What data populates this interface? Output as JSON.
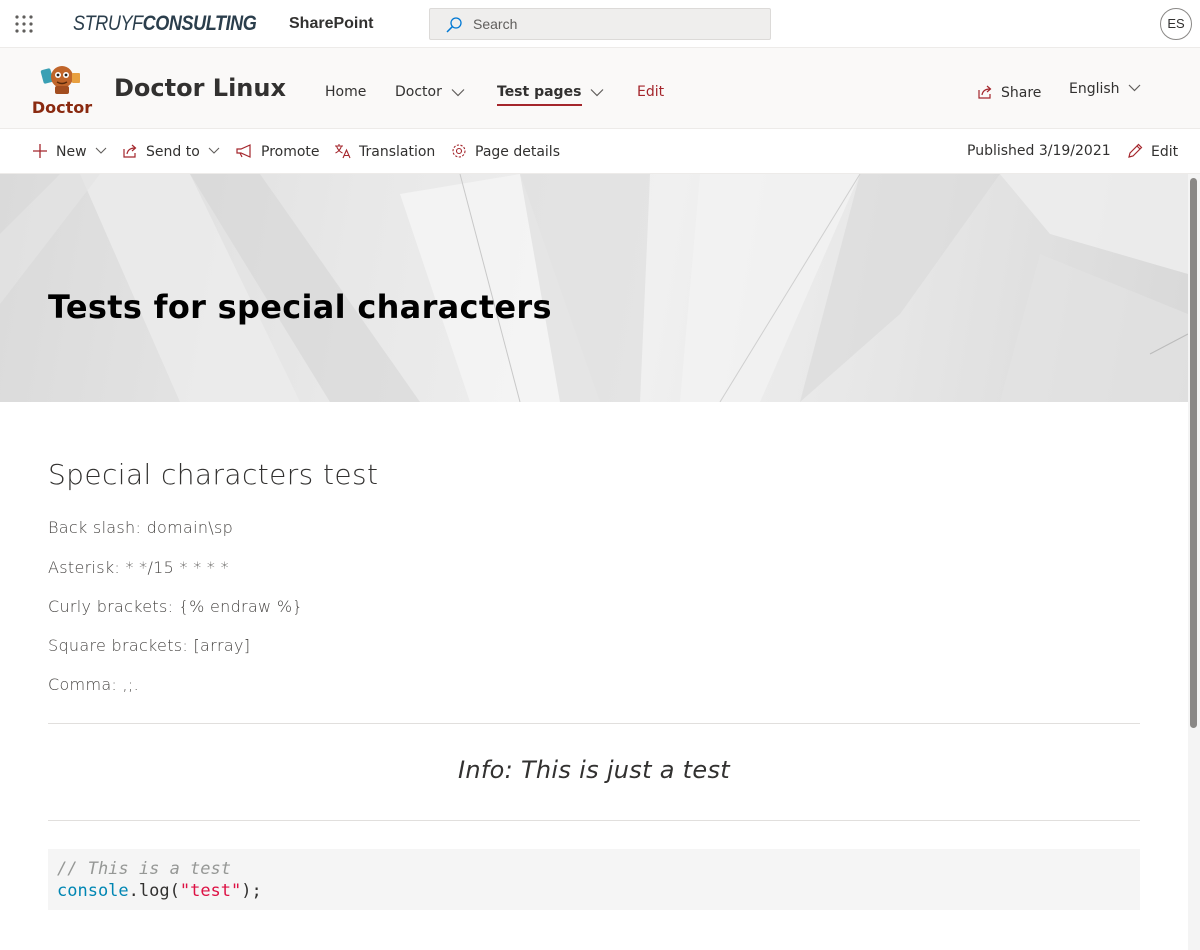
{
  "suite_bar": {
    "brand_part1": "STRUYF",
    "brand_part2": "CONSULTING",
    "app_name": "SharePoint",
    "search_placeholder": "Search",
    "user_initials": "ES"
  },
  "site_header": {
    "logo_text": "Doctor",
    "site_title": "Doctor Linux",
    "nav": [
      {
        "label": "Home"
      },
      {
        "label": "Doctor"
      },
      {
        "label": "Test pages"
      },
      {
        "label": "Edit"
      }
    ],
    "share_label": "Share",
    "language": "English"
  },
  "command_bar": {
    "new_label": "New",
    "send_to_label": "Send to",
    "promote_label": "Promote",
    "translation_label": "Translation",
    "page_details_label": "Page details",
    "published_text": "Published 3/19/2021",
    "edit_label": "Edit"
  },
  "page": {
    "hero_title": "Tests for special characters",
    "section_title": "Special characters test",
    "lines": [
      "Back slash: domain\\sp",
      "Asterisk: * */15 * * * *",
      "Curly brackets: {% endraw %}",
      "Square brackets: [array]",
      "Comma: ,;."
    ],
    "callout": "Info: This is just a test",
    "code": {
      "comment": "// This is a test",
      "obj": "console",
      "method": ".log(",
      "string": "\"test\"",
      "end": ");"
    }
  }
}
